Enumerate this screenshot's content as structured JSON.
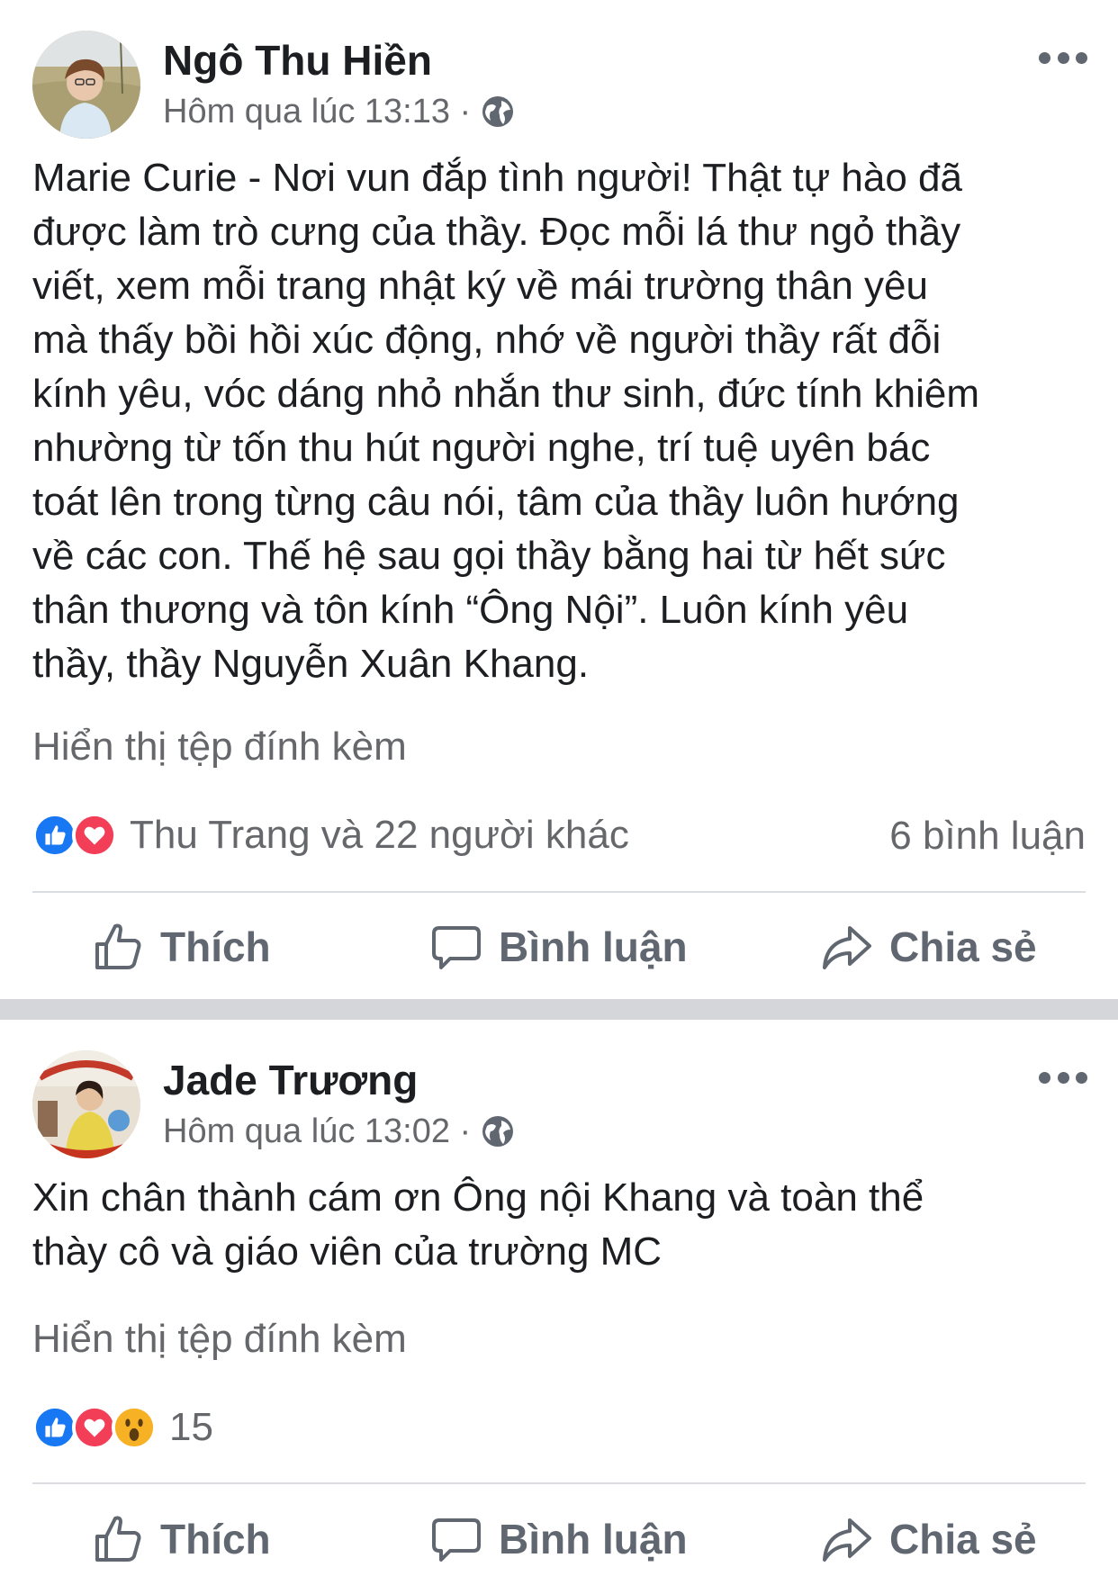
{
  "posts": [
    {
      "author": "Ngô Thu Hiền",
      "time": "Hôm qua lúc 13:13 ·",
      "body_lines": [
        "Marie Curie - Nơi vun đắp tình người! Thật tự hào đã",
        "được làm trò cưng của thầy. Đọc mỗi lá thư ngỏ thầy",
        "viết, xem mỗi trang nhật ký về mái trường thân yêu",
        "mà thấy bồi hồi xúc động, nhớ về người thầy rất đỗi",
        "kính yêu, vóc dáng nhỏ nhắn thư sinh, đức tính khiêm",
        "nhường từ tốn thu hút người nghe, trí tuệ uyên bác",
        "toát lên trong từng câu nói, tâm của thầy luôn hướng",
        "về các con. Thế hệ sau gọi thầy bằng hai từ hết sức",
        "thân thương và tôn kính “Ông Nội”. Luôn kính yêu",
        "thầy, thầy Nguyễn Xuân Khang."
      ],
      "attachment_link": "Hiển thị tệp đính kèm",
      "reactions": [
        "like",
        "love"
      ],
      "reaction_text": "Thu Trang và 22 người khác",
      "comments": "6 bình luận"
    },
    {
      "author": "Jade Trương",
      "time": "Hôm qua lúc 13:02 ·",
      "body_lines": [
        "Xin chân thành cám ơn Ông nội Khang và toàn thể",
        "thày cô và giáo viên của trường MC"
      ],
      "attachment_link": "Hiển thị tệp đính kèm",
      "reactions": [
        "like",
        "love",
        "wow"
      ],
      "reaction_text": "15",
      "comments": ""
    }
  ],
  "actions": {
    "like": "Thích",
    "comment": "Bình luận",
    "share": "Chia sẻ"
  },
  "icons": {
    "globe": "globe-icon",
    "more": "more-options-icon",
    "like": "thumbs-up-icon",
    "comment": "comment-bubble-icon",
    "share": "share-arrow-icon"
  },
  "colors": {
    "like_blue": "#1877f2",
    "love_red": "#f33e58",
    "wow_yellow": "#f7b125",
    "secondary_text": "#65676b",
    "separator": "#d4d6da"
  }
}
